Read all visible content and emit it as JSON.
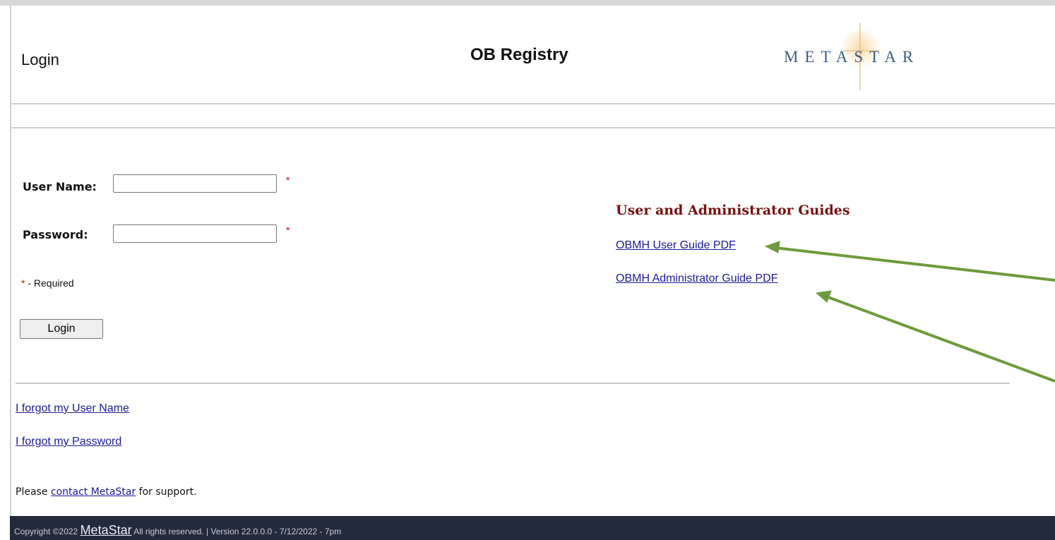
{
  "header": {
    "page_heading": "Login",
    "app_title": "OB Registry",
    "logo_text": "METASTAR"
  },
  "login_form": {
    "username_label": "User Name:",
    "username_value": "",
    "password_label": "Password:",
    "password_value": "",
    "required_mark": "*",
    "required_note": " - Required",
    "login_button": "Login"
  },
  "guides": {
    "heading": "User and Administrator Guides",
    "links": [
      "OBMH User Guide PDF",
      "OBMH Administrator Guide PDF"
    ]
  },
  "help_links": [
    "I forgot my User Name",
    "I forgot my Password"
  ],
  "support": {
    "prefix": "Please ",
    "link": "contact MetaStar",
    "suffix": " for support."
  },
  "footer": {
    "copyright": "Copyright ©2022 ",
    "brand": "MetaStar",
    "rest": " All rights reserved. | Version 22.0.0.0 - 7/12/2022 - 7pm"
  },
  "colors": {
    "heading_maroon": "#7a1010",
    "link_blue": "#1a1a9c",
    "footer_bg": "#232a3e",
    "required_red": "#cc0000",
    "annotation_arrow": "#6e9a3c"
  }
}
